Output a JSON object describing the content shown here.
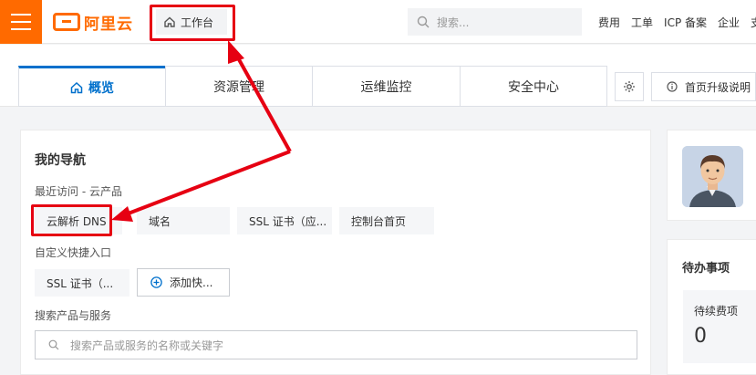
{
  "brand": {
    "name": "阿里云",
    "color": "#ff6a00"
  },
  "header": {
    "workbench_label": "工作台",
    "search_placeholder": "搜索...",
    "nav": [
      "费用",
      "工单",
      "ICP 备案",
      "企业",
      "支"
    ]
  },
  "tabs": [
    {
      "label": "概览",
      "active": true
    },
    {
      "label": "资源管理",
      "active": false
    },
    {
      "label": "运维监控",
      "active": false
    },
    {
      "label": "安全中心",
      "active": false
    }
  ],
  "settings_icon": "gear-icon",
  "upgrade_label": "首页升级说明",
  "nav_card": {
    "title": "我的导航",
    "recent_label": "最近访问 - 云产品",
    "recent_items": [
      "云解析 DNS",
      "域名",
      "SSL 证书（应...",
      "控制台首页"
    ],
    "custom_label": "自定义快捷入口",
    "custom_items": [
      "SSL 证书（..."
    ],
    "add_label": "添加快...",
    "search_label": "搜索产品与服务",
    "search_placeholder": "搜索产品或服务的名称或关键字"
  },
  "todo_card": {
    "title": "待办事项",
    "items": [
      {
        "label": "待续费项",
        "count": "0"
      }
    ]
  },
  "annotation_color": "#e60012"
}
